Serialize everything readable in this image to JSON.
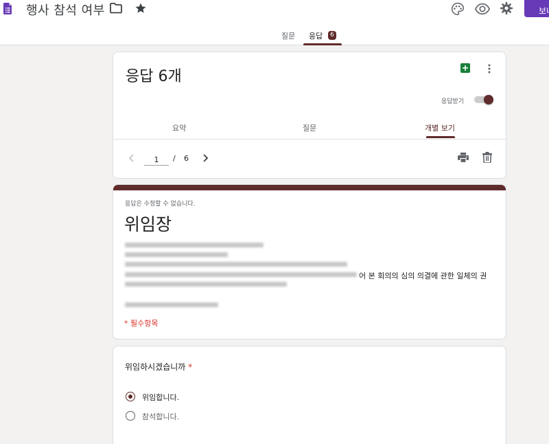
{
  "app": {
    "title": "행사 참석 여부",
    "send_label": "보내",
    "tabs": [
      {
        "label": "질문"
      },
      {
        "label": "응답",
        "badge": "6"
      }
    ]
  },
  "responses": {
    "title": "응답 6개",
    "accepting_label": "응답받기",
    "accepting": true,
    "subtabs": [
      {
        "label": "요약"
      },
      {
        "label": "질문"
      },
      {
        "label": "개별 보기"
      }
    ],
    "pager": {
      "current": "1",
      "separator": "/",
      "total": "6"
    }
  },
  "form": {
    "readonly_notice": "응답은 수정할 수 없습니다.",
    "title": "위임장",
    "description_visible_tail": "어 본 회의의 심의 의결에 관한 일체의 권",
    "required_note": "* 필수항목"
  },
  "question": {
    "title": "위임하시겠습니까",
    "required_mark": "*",
    "options": [
      {
        "label": "위임합니다.",
        "selected": true
      },
      {
        "label": "참석합니다.",
        "selected": false
      }
    ]
  },
  "colors": {
    "accent": "#5f2b2b",
    "send_button": "#673ab7",
    "required": "#d93025",
    "sheets": "#188038"
  }
}
